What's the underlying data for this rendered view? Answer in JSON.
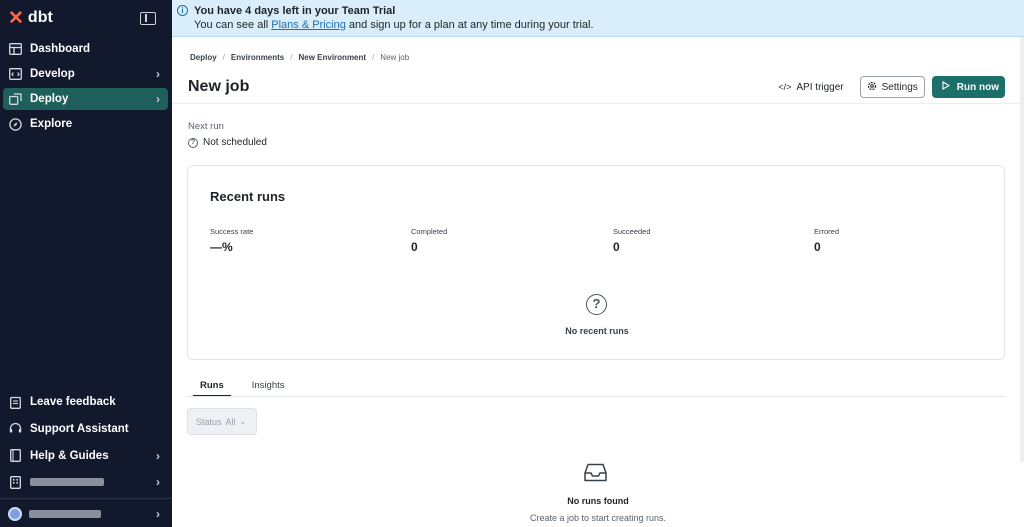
{
  "app": {
    "logo_text": "dbt",
    "brand_color": "#ff694a"
  },
  "sidebar": {
    "items": [
      {
        "label": "Dashboard",
        "icon": "dashboard-icon",
        "active": false
      },
      {
        "label": "Develop",
        "icon": "code-icon",
        "active": false
      },
      {
        "label": "Deploy",
        "icon": "deploy-icon",
        "active": true
      },
      {
        "label": "Explore",
        "icon": "compass-icon",
        "active": false
      }
    ],
    "bottom_items": [
      {
        "label": "Leave feedback",
        "icon": "clipboard-icon"
      },
      {
        "label": "Support Assistant",
        "icon": "headset-icon"
      },
      {
        "label": "Help & Guides",
        "icon": "book-icon"
      }
    ],
    "active_color": "#1f5f5b"
  },
  "banner": {
    "title": "You have 4 days left in your Team Trial",
    "text_before": "You can see all ",
    "link": "Plans & Pricing",
    "text_after": " and sign up for a plan at any time during your trial."
  },
  "breadcrumb": [
    "Deploy",
    "Environments",
    "New Environment",
    "New job"
  ],
  "header": {
    "title": "New job",
    "api_trigger_label": "API trigger",
    "settings_label": "Settings",
    "run_now_label": "Run now",
    "primary_color": "#1d6f69"
  },
  "next_run": {
    "label": "Next run",
    "value": "Not scheduled"
  },
  "recent_runs": {
    "title": "Recent runs",
    "stats": [
      {
        "label": "Success rate",
        "value": "—%"
      },
      {
        "label": "Completed",
        "value": "0"
      },
      {
        "label": "Succeeded",
        "value": "0"
      },
      {
        "label": "Errored",
        "value": "0"
      }
    ],
    "empty_text": "No recent runs"
  },
  "tabs": [
    "Runs",
    "Insights"
  ],
  "filter": {
    "label": "Status",
    "value": "All"
  },
  "runs_empty": {
    "title": "No runs found",
    "subtitle": "Create a job to start creating runs."
  }
}
